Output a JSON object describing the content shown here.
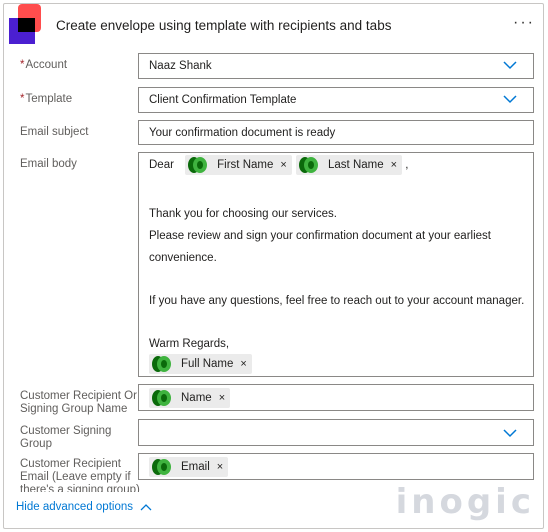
{
  "header": {
    "title": "Create envelope using template with recipients and tabs",
    "more_label": "···"
  },
  "fields": {
    "account": {
      "label": "Account",
      "value": "Naaz Shank"
    },
    "template": {
      "label": "Template",
      "value": "Client Confirmation Template"
    },
    "email_subject": {
      "label": "Email subject",
      "value": "Your confirmation document is ready"
    },
    "email_body": {
      "label": "Email body",
      "dear": "Dear",
      "token_first": "First Name",
      "token_last": "Last Name",
      "comma": ",",
      "line1": "Thank you for choosing our services.",
      "line2": "Please review and sign your confirmation document at your earliest",
      "line3": "convenience.",
      "line4": "If you have any questions, feel free to reach out to your account manager.",
      "line5": "Warm Regards,",
      "token_full": "Full Name"
    },
    "customer_recipient": {
      "label_line1": "Customer Recipient Or",
      "label_line2": "Signing Group Name",
      "token": "Name"
    },
    "customer_signing_group": {
      "label_line1": "Customer Signing",
      "label_line2": "Group",
      "value": ""
    },
    "customer_email": {
      "label_line1": "Customer Recipient",
      "label_line2": "Email (Leave empty if",
      "label_line3": "there's a signing group)",
      "token": "Email"
    }
  },
  "footer": {
    "hide_advanced": "Hide advanced options"
  },
  "watermark": "inogic",
  "token_remove": "×",
  "colors": {
    "accent": "#0078d4",
    "required": "#a4262c",
    "border": "#8a8886"
  }
}
